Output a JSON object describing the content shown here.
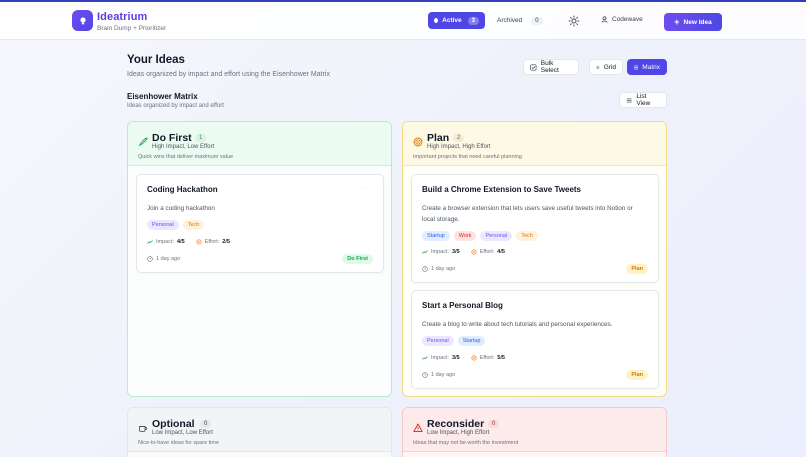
{
  "header": {
    "brand": "Ideatrium",
    "tagline": "Brain Dump + Prioritizer",
    "active_label": "Active",
    "active_count": "3",
    "archived_label": "Archived",
    "archived_count": "0",
    "user_name": "Codewave",
    "new_idea_label": "New Idea"
  },
  "page": {
    "title": "Your Ideas",
    "subtitle": "Ideas organized by impact and effort using the Eisenhower Matrix",
    "bulk_select_label": "Bulk Select",
    "grid_label": "Grid",
    "matrix_label": "Matrix",
    "section_title": "Eisenhower Matrix",
    "section_subtitle": "Ideas organized by impact and effort",
    "list_view_label": "List View"
  },
  "quadrants": [
    {
      "title": "Do First",
      "count": "1",
      "meta": "High Impact, Low Effort",
      "desc": "Quick wins that deliver maximum value",
      "cards": [
        {
          "title": "Coding Hackathon",
          "desc": "Join a coding hackathon",
          "tags": [
            "Personal",
            "Tech"
          ],
          "impact_label": "Impact:",
          "impact": "4/5",
          "effort_label": "Effort:",
          "effort": "2/5",
          "time": "1 day ago",
          "badge": "Do First"
        }
      ]
    },
    {
      "title": "Plan",
      "count": "2",
      "meta": "High Impact, High Effort",
      "desc": "Important projects that need careful planning",
      "cards": [
        {
          "title": "Build a Chrome Extension to Save Tweets",
          "desc_line1": "Create a browser extension that lets users save useful tweets into Notion or",
          "desc_line2": "local storage.",
          "tags": [
            "Startup",
            "Work",
            "Personal",
            "Tech"
          ],
          "impact_label": "Impact:",
          "impact": "3/5",
          "effort_label": "Effort:",
          "effort": "4/5",
          "time": "1 day ago",
          "badge": "Plan"
        },
        {
          "title": "Start a Personal Blog",
          "desc": "Create a blog to write about tech tutorials and personal experiences.",
          "tags": [
            "Personal",
            "Startup"
          ],
          "impact_label": "Impact:",
          "impact": "3/5",
          "effort_label": "Effort:",
          "effort": "5/5",
          "time": "1 day ago",
          "badge": "Plan"
        }
      ]
    },
    {
      "title": "Optional",
      "count": "0",
      "meta": "Low Impact, Low Effort",
      "desc": "Nice-to-have ideas for spare time"
    },
    {
      "title": "Reconsider",
      "count": "0",
      "meta": "Low Impact, High Effort",
      "desc": "Ideas that may not be worth the investment"
    }
  ],
  "colors": {
    "accent": "#4f46e5",
    "brand": "#5b3de0",
    "do_first": "#16a34a",
    "plan": "#d97706",
    "reconsider": "#dc2626"
  }
}
